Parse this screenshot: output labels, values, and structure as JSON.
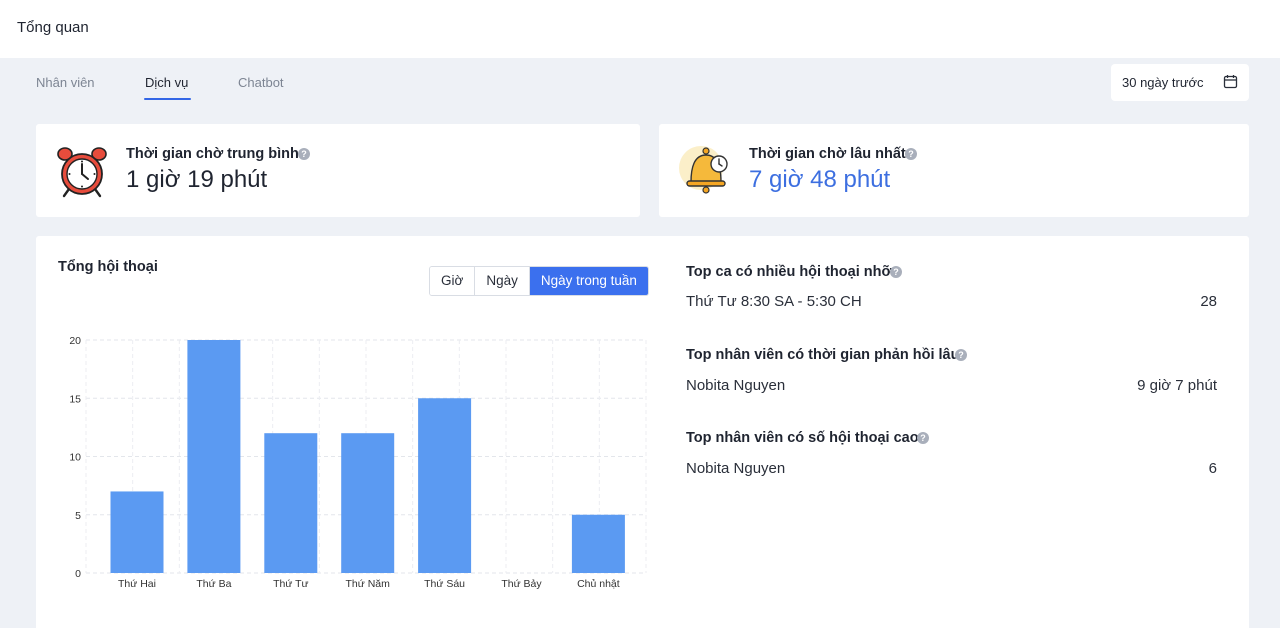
{
  "header": {
    "title": "Tổng quan"
  },
  "tabs": [
    {
      "label": "Nhân viên",
      "active": false
    },
    {
      "label": "Dịch vụ",
      "active": true
    },
    {
      "label": "Chatbot",
      "active": false
    }
  ],
  "date_range": {
    "label": "30 ngày trước",
    "icon": "calendar-icon"
  },
  "stats": {
    "avg_wait": {
      "label": "Thời gian chờ trung bình",
      "value": "1 giờ 19 phút",
      "icon": "alarm-clock-icon"
    },
    "max_wait": {
      "label": "Thời gian chờ lâu nhất",
      "value": "7 giờ 48 phút",
      "icon": "bell-icon"
    }
  },
  "conversations": {
    "title": "Tổng hội thoại",
    "filters": [
      {
        "label": "Giờ",
        "active": false
      },
      {
        "label": "Ngày",
        "active": false
      },
      {
        "label": "Ngày trong tuần",
        "active": true
      }
    ]
  },
  "chart_data": {
    "type": "bar",
    "categories": [
      "Thứ Hai",
      "Thứ Ba",
      "Thứ Tư",
      "Thứ Năm",
      "Thứ Sáu",
      "Thứ Bảy",
      "Chủ nhật"
    ],
    "values": [
      7,
      20,
      12,
      12,
      15,
      0,
      5
    ],
    "ylim": [
      0,
      20
    ],
    "yticks": [
      "0",
      "5",
      "10",
      "15",
      "20"
    ],
    "grid": true,
    "bar_color": "#5b9af2"
  },
  "top_lists": [
    {
      "title": "Top ca có nhiều hội thoại nhỡ",
      "name": "Thứ Tư 8:30 SA - 5:30 CH",
      "value": "28"
    },
    {
      "title": "Top nhân viên có thời gian phản hồi lâu",
      "name": "Nobita Nguyen",
      "value": "9 giờ 7 phút"
    },
    {
      "title": "Top nhân viên có số hội thoại cao",
      "name": "Nobita Nguyen",
      "value": "6"
    }
  ],
  "colors": {
    "accent": "#3b70ee",
    "highlight_value": "#3d6fe0",
    "background": "#eef1f6"
  }
}
